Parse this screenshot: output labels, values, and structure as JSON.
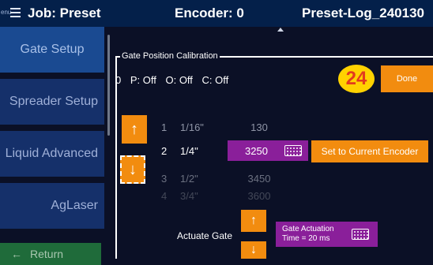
{
  "header": {
    "menu_label": "enu",
    "job": "Job: Preset",
    "encoder": "Encoder: 0",
    "log": "Preset-Log_240130"
  },
  "sidebar": {
    "items": [
      {
        "label": "Gate Setup"
      },
      {
        "label": "Spreader Setup"
      },
      {
        "label": "Liquid Advanced"
      },
      {
        "label": "AgLaser"
      }
    ],
    "return_label": "Return"
  },
  "calibration": {
    "legend": "Gate Position Calibration",
    "status": [
      "0",
      "P: Off",
      "O: Off",
      "C: Off"
    ],
    "badge": "24",
    "done_label": "Done",
    "rows": [
      {
        "idx": "1",
        "size": "1/16\"",
        "value": "130"
      },
      {
        "idx": "2",
        "size": "1/4\"",
        "value": "3250"
      },
      {
        "idx": "3",
        "size": "1/2\"",
        "value": "3450"
      },
      {
        "idx": "4",
        "size": "3/4\"",
        "value": "3600"
      }
    ],
    "set_encoder_label": "Set to Current Encoder",
    "actuate_label": "Actuate Gate",
    "gate_actuation_line1": "Gate Actuation",
    "gate_actuation_line2": "Time = 20 ms"
  },
  "colors": {
    "background": "#0b1026",
    "header": "#04204a",
    "orange": "#f28c0f",
    "purple": "#8a1f9a",
    "badge": "#ffd200"
  }
}
